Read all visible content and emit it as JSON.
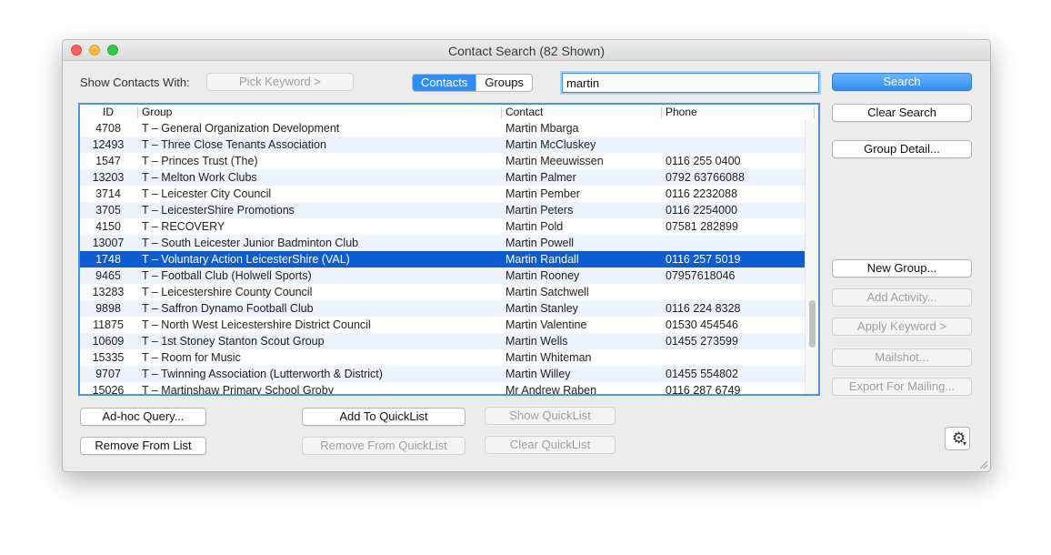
{
  "window": {
    "title": "Contact Search (82 Shown)"
  },
  "toolbar": {
    "show_contacts_label": "Show Contacts With:",
    "pick_keyword_label": "Pick Keyword  >",
    "segment": {
      "contacts": "Contacts",
      "groups": "Groups",
      "selected": "Contacts"
    },
    "search_value": "martin",
    "search_button": "Search"
  },
  "table": {
    "columns": {
      "id": "ID",
      "group": "Group",
      "contact": "Contact",
      "phone": "Phone"
    },
    "rows": [
      {
        "id": "4708",
        "group": "T – General Organization Development",
        "contact": "Martin Mbarga",
        "phone": ""
      },
      {
        "id": "12493",
        "group": "T – Three Close Tenants Association",
        "contact": "Martin McCluskey",
        "phone": ""
      },
      {
        "id": "1547",
        "group": "T – Princes Trust (The)",
        "contact": "Martin Meeuwissen",
        "phone": "0116 255 0400"
      },
      {
        "id": "13203",
        "group": "T – Melton Work Clubs",
        "contact": "Martin Palmer",
        "phone": "0792 63766088"
      },
      {
        "id": "3714",
        "group": "T – Leicester City Council",
        "contact": "Martin Pember",
        "phone": "0116 2232088"
      },
      {
        "id": "3705",
        "group": "T – LeicesterShire Promotions",
        "contact": "Martin Peters",
        "phone": "0116 2254000"
      },
      {
        "id": "4150",
        "group": "T – RECOVERY",
        "contact": "Martin Pold",
        "phone": "07581 282899"
      },
      {
        "id": "13007",
        "group": "T – South Leicester Junior Badminton Club",
        "contact": "Martin Powell",
        "phone": ""
      },
      {
        "id": "1748",
        "group": "T – Voluntary Action LeicesterShire (VAL)",
        "contact": "Martin Randall",
        "phone": "0116 257 5019"
      },
      {
        "id": "9465",
        "group": "T – Football Club (Holwell Sports)",
        "contact": "Martin Rooney",
        "phone": "07957618046"
      },
      {
        "id": "13283",
        "group": "T – Leicestershire County Council",
        "contact": "Martin Satchwell",
        "phone": ""
      },
      {
        "id": "9898",
        "group": "T – Saffron Dynamo Football Club",
        "contact": "Martin Stanley",
        "phone": "0116 224 8328"
      },
      {
        "id": "11875",
        "group": "T – North West Leicestershire District Council",
        "contact": "Martin Valentine",
        "phone": "01530 454546"
      },
      {
        "id": "10609",
        "group": "T – 1st Stoney Stanton Scout Group",
        "contact": "Martin Wells",
        "phone": "01455 273599"
      },
      {
        "id": "15335",
        "group": "T – Room for Music",
        "contact": "Martin Whiteman",
        "phone": ""
      },
      {
        "id": "9707",
        "group": "T – Twinning Association (Lutterworth & District)",
        "contact": "Martin Willey",
        "phone": "01455 554802"
      },
      {
        "id": "15026",
        "group": "T – Martinshaw Primary School Groby",
        "contact": "Mr Andrew Raben",
        "phone": "0116 287 6749"
      }
    ],
    "selected_id": "1748"
  },
  "side_buttons": {
    "clear_search": "Clear Search",
    "group_detail": "Group Detail...",
    "new_group": "New Group...",
    "add_activity": "Add Activity...",
    "apply_keyword": "Apply Keyword  >",
    "mailshot": "Mailshot...",
    "export_for_mailing": "Export For Mailing..."
  },
  "bottom_buttons": {
    "adhoc_query": "Ad-hoc Query...",
    "remove_from_list": "Remove From List",
    "add_to_quicklist": "Add To QuickList",
    "remove_from_quicklist": "Remove From QuickList",
    "show_quicklist": "Show QuickList",
    "clear_quicklist": "Clear QuickList"
  },
  "icons": {
    "gear": "gear-icon",
    "dropdown": "chevron-down-icon"
  }
}
